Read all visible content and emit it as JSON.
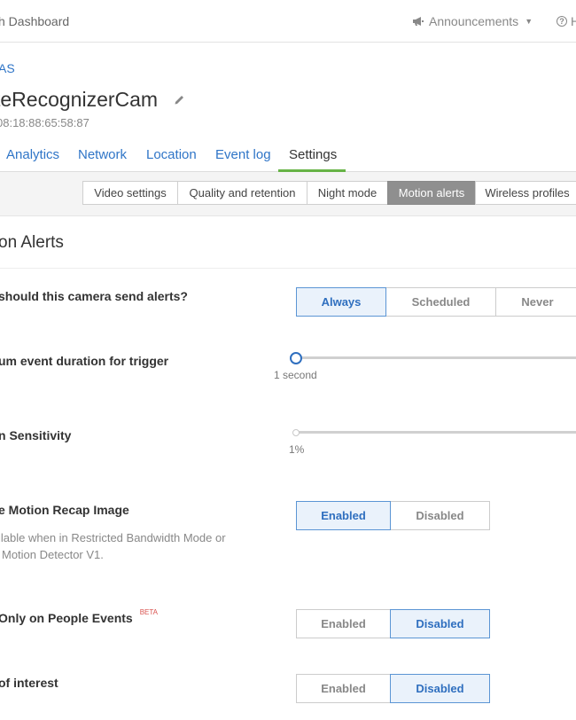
{
  "topbar": {
    "title": "h Dashboard",
    "announcements": "Announcements",
    "help": "H"
  },
  "breadcrumb": "AS",
  "camera": {
    "name": "teRecognizerCam",
    "mac": "08:18:88:65:58:87"
  },
  "tabs": [
    "Analytics",
    "Network",
    "Location",
    "Event log",
    "Settings"
  ],
  "active_tab": "Settings",
  "subtabs": [
    "Video settings",
    "Quality and retention",
    "Night mode",
    "Motion alerts",
    "Wireless profiles"
  ],
  "active_subtab": "Motion alerts",
  "section_title": "on Alerts",
  "rows": {
    "when": {
      "label": "should this camera send alerts?",
      "options": [
        "Always",
        "Scheduled",
        "Never"
      ],
      "selected": "Always"
    },
    "duration": {
      "label": "um event duration for trigger",
      "value_text": "1 second",
      "value": 0
    },
    "sensitivity": {
      "label": "n Sensitivity",
      "value_text": "1%",
      "value": 0.01
    },
    "recap": {
      "label": "e Motion Recap Image",
      "desc_line1": "ilable when in Restricted Bandwidth Mode or",
      "desc_line2": "Motion Detector V1.",
      "options": [
        "Enabled",
        "Disabled"
      ],
      "selected": "Enabled"
    },
    "people": {
      "label": "Only on People Events",
      "badge": "BETA",
      "options": [
        "Enabled",
        "Disabled"
      ],
      "selected": "Disabled"
    },
    "interest": {
      "label": "of interest",
      "options": [
        "Enabled",
        "Disabled"
      ],
      "selected": "Disabled"
    }
  },
  "colors": {
    "link": "#2f75c7",
    "active_underline": "#67b346",
    "selected_button_bg": "#eaf2fb",
    "selected_button_border": "#5b95d4",
    "badge": "#d9534f"
  }
}
